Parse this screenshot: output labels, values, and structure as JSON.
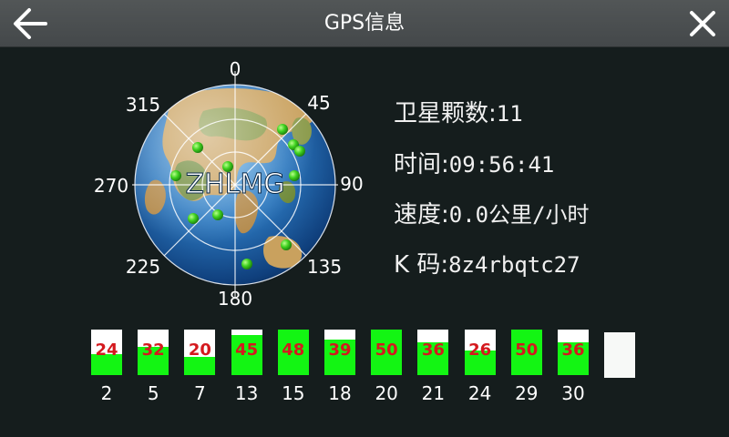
{
  "header": {
    "title": "GPS信息",
    "back_icon": "arrow-left-icon",
    "close_icon": "close-icon"
  },
  "sky": {
    "center_label": "ZHLMG",
    "angles": [
      "0",
      "45",
      "90",
      "135",
      "180",
      "225",
      "270",
      "315"
    ]
  },
  "info": {
    "satellites": {
      "label": "卫星颗数:",
      "value": "11"
    },
    "time": {
      "label": "时间:",
      "value": "09:56:41"
    },
    "speed": {
      "label": "速度:",
      "value": "0.0公里/小时"
    },
    "code": {
      "label": "K 码:",
      "value": "8z4rbqtc27"
    }
  },
  "satellites": [
    {
      "prn": "2",
      "snr": "24",
      "level": 0.46
    },
    {
      "prn": "5",
      "snr": "32",
      "level": 0.62
    },
    {
      "prn": "7",
      "snr": "20",
      "level": 0.4
    },
    {
      "prn": "13",
      "snr": "45",
      "level": 0.88
    },
    {
      "prn": "15",
      "snr": "48",
      "level": 1.0
    },
    {
      "prn": "18",
      "snr": "39",
      "level": 0.78
    },
    {
      "prn": "20",
      "snr": "50",
      "level": 1.0
    },
    {
      "prn": "21",
      "snr": "36",
      "level": 0.72
    },
    {
      "prn": "24",
      "snr": "26",
      "level": 0.54
    },
    {
      "prn": "29",
      "snr": "50",
      "level": 1.0
    },
    {
      "prn": "30",
      "snr": "36",
      "level": 0.72
    }
  ],
  "colors": {
    "background": "#151d1d",
    "titlebar": "#4a4e50",
    "bar_fill": "#13f513",
    "bar_empty": "#ffffff",
    "snr_text": "#d4191e",
    "sat_dot": "#3fd11f"
  }
}
